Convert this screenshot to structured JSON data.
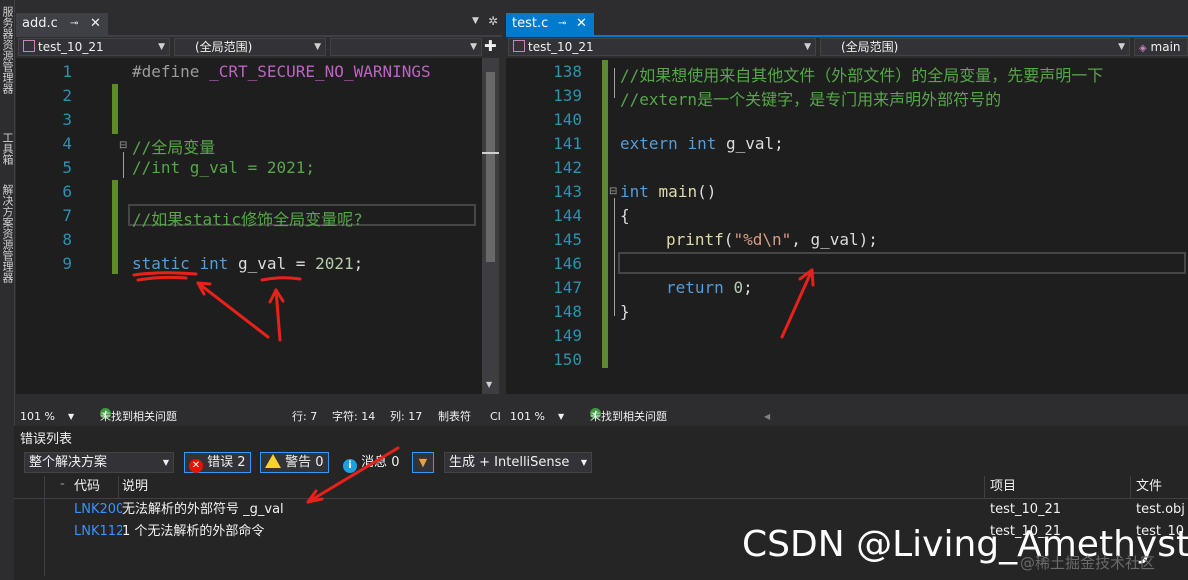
{
  "side_tabs": [
    "服务器资源管理器",
    "工具箱",
    "解决方案资源管理器"
  ],
  "left_pane": {
    "tab_label": "add.c",
    "pin_glyph": "⊸",
    "close_glyph": "✕",
    "nav_project": "test_10_21",
    "nav_scope": "(全局范围)",
    "nav_member": "",
    "line_numbers": [
      "1",
      "2",
      "3",
      "4",
      "5",
      "6",
      "7",
      "8",
      "9"
    ],
    "code": {
      "l1_pp": "#define",
      "l1_macro": " _CRT_SECURE_NO_WARNINGS",
      "l4_comment": "//全局变量",
      "l5_comment": "//int g_val = 2021;",
      "l7_comment": "//如果static修饰全局变量呢?",
      "l9_kw1": "static",
      "l9_kw2": "int",
      "l9_ident": "g_val",
      "l9_rest": "= ",
      "l9_num": "2021",
      "l9_end": ";"
    },
    "status": {
      "zoom": "101 %",
      "health": "未找到相关问题",
      "row": "行: 7",
      "char": "字符: 14",
      "col": "列: 17",
      "tabs": "制表符",
      "crlf": "CI"
    }
  },
  "right_pane": {
    "tab_label": "test.c",
    "pin_glyph": "⊸",
    "close_glyph": "✕",
    "nav_project": "test_10_21",
    "nav_scope": "(全局范围)",
    "nav_member": "main",
    "line_numbers": [
      "138",
      "139",
      "140",
      "141",
      "142",
      "143",
      "144",
      "145",
      "146",
      "147",
      "148",
      "149",
      "150"
    ],
    "code": {
      "l138_comment": "//如果想使用来自其他文件（外部文件）的全局变量，先要声明一下",
      "l139_comment": "//extern是一个关键字，是专门用来声明外部符号的",
      "l141_kw1": "extern",
      "l141_kw2": "int",
      "l141_rest": "g_val;",
      "l143_kw": "int",
      "l143_fn": "main",
      "l143_rest": "()",
      "l144": "{",
      "l145_fn": "printf",
      "l145_open": "(",
      "l145_str": "\"%d\\n\"",
      "l145_rest": ", g_val);",
      "l147_kw": "return",
      "l147_num": "0",
      "l147_end": ";",
      "l148": "}"
    },
    "status": {
      "zoom": "101 %",
      "health": "未找到相关问题"
    }
  },
  "error_list": {
    "title": "错误列表",
    "scope": "整个解决方案",
    "errors_label": "错误 2",
    "warnings_label": "警告 0",
    "messages_label": "消息 0",
    "build_filter": "生成 + IntelliSense",
    "columns": {
      "code": "代码",
      "description": "说明",
      "project": "项目",
      "file": "文件"
    },
    "rows": [
      {
        "code": "LNK2001",
        "description": "无法解析的外部符号 _g_val",
        "project": "test_10_21",
        "file": "test.obj"
      },
      {
        "code": "LNK1120",
        "description": "1 个无法解析的外部命令",
        "project": "test_10_21",
        "file": "test_10_"
      }
    ]
  },
  "watermark": {
    "main": "CSDN @Living_Amethyst",
    "sub": "@稀土掘金技术社区"
  },
  "colors": {
    "editor_bg": "#1e1e1e",
    "keyword": "#569cd6",
    "comment": "#57a64a",
    "number": "#b5cea8",
    "string": "#d69d85",
    "line_number": "#2b91af",
    "error_red": "#e51400",
    "annotation_red": "#e8221a",
    "active_tab": "#007acc"
  }
}
